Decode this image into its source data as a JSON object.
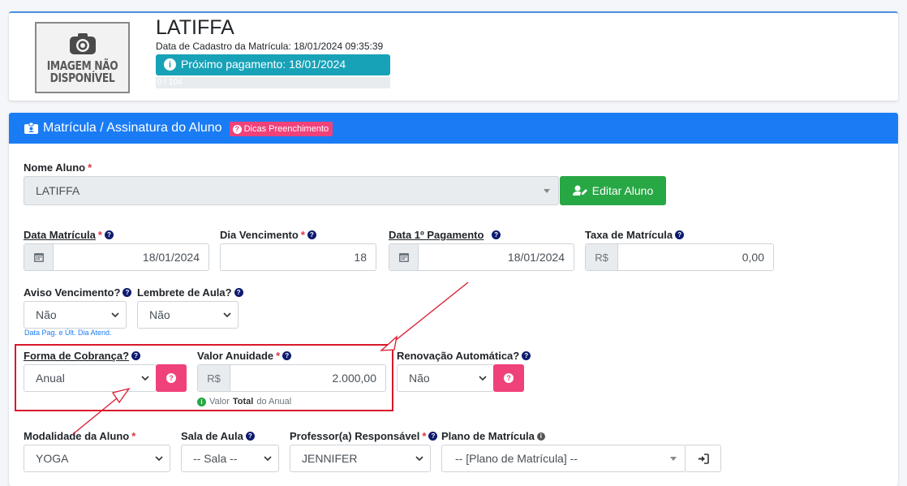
{
  "student": {
    "photo_text": "IMAGEM NÃO DISPONÍVEL",
    "name": "LATIFFA",
    "registration_date": "Data de Cadastro da Matrícula: 18/01/2024 09:35:39",
    "next_payment": "Próximo pagamento: 18/01/2024",
    "progress_text": "0 / 104",
    "progress_value": 0
  },
  "card": {
    "title": "Matrícula / Assinatura do Aluno",
    "tips_badge": "Dicas Preenchimento"
  },
  "form": {
    "nome_aluno": {
      "label": "Nome Aluno",
      "value": "LATIFFA"
    },
    "edit_button": "Editar Aluno",
    "data_matricula": {
      "label": "Data Matrícula",
      "value": "18/01/2024"
    },
    "dia_vencimento": {
      "label": "Dia Vencimento",
      "value": "18"
    },
    "data_primeiro_pagamento": {
      "label": "Data 1º Pagamento",
      "value": "18/01/2024"
    },
    "taxa_matricula": {
      "label": "Taxa de Matrícula",
      "currency": "R$",
      "value": "0,00"
    },
    "aviso_vencimento": {
      "label": "Aviso Vencimento?",
      "value": "Não",
      "note": "Data Pag. e Últ. Dia Atend."
    },
    "lembrete_aula": {
      "label": "Lembrete de Aula?",
      "value": "Não"
    },
    "forma_cobranca": {
      "label": "Forma de Cobrança?",
      "value": "Anual"
    },
    "valor_anuidade": {
      "label": "Valor Anuidade",
      "currency": "R$",
      "value": "2.000,00",
      "hint_pre": "Valor",
      "hint_bold": "Total",
      "hint_post": "do Anual"
    },
    "renovacao_automatica": {
      "label": "Renovação Automática?",
      "value": "Não"
    },
    "modalidade": {
      "label": "Modalidade da Aluno",
      "value": "YOGA"
    },
    "sala_aula": {
      "label": "Sala de Aula",
      "value": "-- Sala --"
    },
    "professor": {
      "label": "Professor(a) Responsável",
      "value": "JENNIFER"
    },
    "plano_matricula": {
      "label": "Plano de Matrícula",
      "value": "-- [Plano de Matrícula] --"
    }
  },
  "colors": {
    "primary": "#1a7cf5",
    "success": "#28a745",
    "info": "#17a2b8",
    "pink": "#f0427a",
    "annotation_red": "#d9182c"
  }
}
